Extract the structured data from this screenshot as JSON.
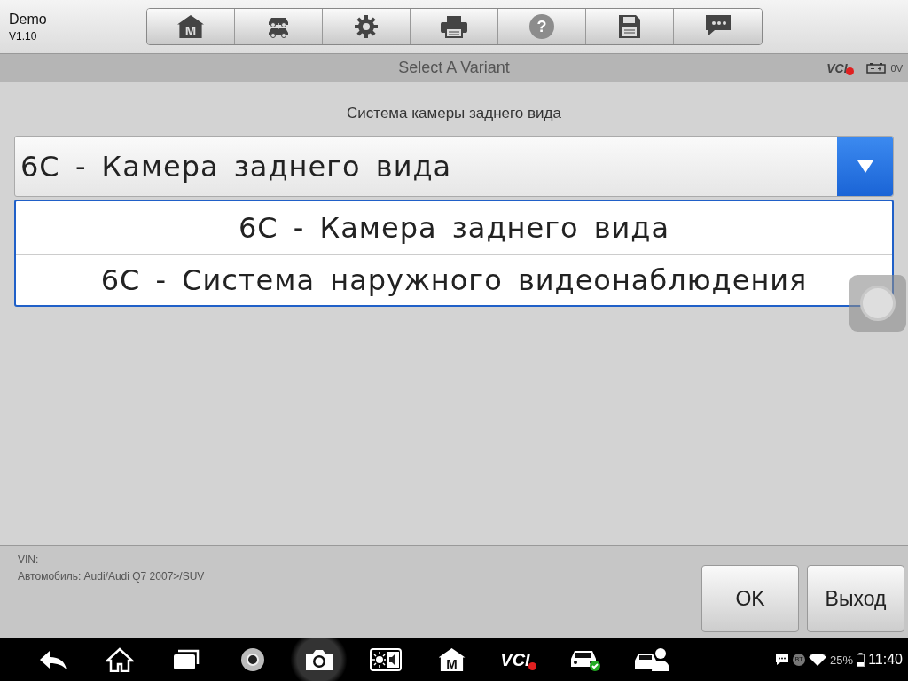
{
  "header": {
    "app_name": "Demo",
    "version": "V1.10",
    "toolbar": [
      {
        "kind": "home",
        "label": "M",
        "disabled": false
      },
      {
        "kind": "vehicle-swap",
        "disabled": false
      },
      {
        "kind": "settings",
        "disabled": false
      },
      {
        "kind": "print",
        "disabled": false
      },
      {
        "kind": "help",
        "label": "?",
        "disabled": true
      },
      {
        "kind": "save",
        "disabled": false
      },
      {
        "kind": "chat",
        "disabled": false
      }
    ]
  },
  "title_bar": {
    "title": "Select A Variant",
    "vci_label": "VCI",
    "vci_connected": false,
    "voltage": "0V"
  },
  "content": {
    "prompt": "Система камеры заднего вида",
    "dropdown": {
      "value": "6C - Камера заднего вида",
      "expanded": true,
      "options": [
        {
          "label": "6C - Камера заднего вида"
        },
        {
          "label": "6C - Система наружного видеонаблюдения"
        }
      ]
    }
  },
  "footer": {
    "vin_label": "VIN:",
    "vehicle": "Автомобиль: Audi/Audi Q7 2007>/SUV",
    "buttons": [
      "OK",
      "Выход"
    ]
  },
  "nav_bar": {
    "items": [
      {
        "kind": "back"
      },
      {
        "kind": "home"
      },
      {
        "kind": "recents"
      },
      {
        "kind": "browser"
      },
      {
        "kind": "camera",
        "selected": true
      },
      {
        "kind": "display"
      },
      {
        "kind": "app-home",
        "label": "M"
      },
      {
        "kind": "vci",
        "label": "VCI"
      },
      {
        "kind": "car-check"
      },
      {
        "kind": "car-person"
      }
    ],
    "status": {
      "bt_label": "BT",
      "battery": "25%",
      "time": "11:40"
    }
  }
}
